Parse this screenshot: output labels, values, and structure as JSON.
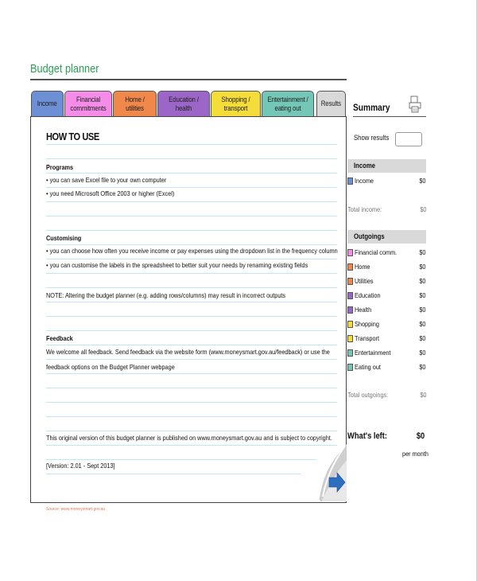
{
  "title": "Budget planner",
  "tabs": [
    {
      "label": "Income",
      "color": "#6d8fd6"
    },
    {
      "label": "Financial commitments",
      "color": "#f58ce8"
    },
    {
      "label": "Home / utilities",
      "color": "#f0874b"
    },
    {
      "label": "Education / health",
      "color": "#9b66c8"
    },
    {
      "label": "Shopping / transport",
      "color": "#f4dc3a"
    },
    {
      "label": "Entertainment / eating out",
      "color": "#74c7b6"
    },
    {
      "label": "Results",
      "color": "#d9d9d9"
    }
  ],
  "howto": {
    "heading": "HOW TO USE",
    "programs_heading": "Programs",
    "programs": [
      "• you can save Excel file to your own computer",
      "• you need Microsoft Office 2003 or higher (Excel)"
    ],
    "customising_heading": "Customising",
    "customising": [
      "• you can choose how often you receive income or pay expenses using the dropdown list in the frequency column",
      "• you can customise the labels in the spreadsheet to better suit your needs by renaming existing fields"
    ],
    "note": "NOTE: Altering the budget planner (e.g. adding rows/columns) may result in incorrect outputs",
    "feedback_heading": "Feedback",
    "feedback_lines": [
      "We welcome all feedback. Send feedback via the website form (www.moneysmart.gov.au/feedback) or use the",
      "feedback options on the Budget Planner webpage"
    ],
    "original": "This original version of this budget planner is published on www.moneysmart.gov.au and is subject to copyright.",
    "version": "[Version:  2.01 - Sept 2013]"
  },
  "summary": {
    "title": "Summary",
    "show_results": "Show results",
    "income_header": "Income",
    "income_rows": [
      {
        "label": "Income",
        "value": "$0",
        "color": "#6d8fd6"
      }
    ],
    "total_income_label": "Total income:",
    "total_income_value": "$0",
    "outgoings_header": "Outgoings",
    "outgoing_rows": [
      {
        "label": "Financial comm.",
        "value": "$0",
        "color": "#f58ce8"
      },
      {
        "label": "Home",
        "value": "$0",
        "color": "#f0874b"
      },
      {
        "label": "Utilities",
        "value": "$0",
        "color": "#f0874b"
      },
      {
        "label": "Education",
        "value": "$0",
        "color": "#9b66c8"
      },
      {
        "label": "Health",
        "value": "$0",
        "color": "#9b66c8"
      },
      {
        "label": "Shopping",
        "value": "$0",
        "color": "#f4dc3a"
      },
      {
        "label": "Transport",
        "value": "$0",
        "color": "#f4dc3a"
      },
      {
        "label": "Entertainment",
        "value": "$0",
        "color": "#74c7b6"
      },
      {
        "label": "Eating out",
        "value": "$0",
        "color": "#74c7b6"
      }
    ],
    "total_outgoings_label": "Total outgoings:",
    "total_outgoings_value": "$0",
    "whats_left_label": "What's left:",
    "whats_left_value": "$0",
    "per_month": "per month"
  },
  "source": "Source: www.moneysmart.gov.au"
}
